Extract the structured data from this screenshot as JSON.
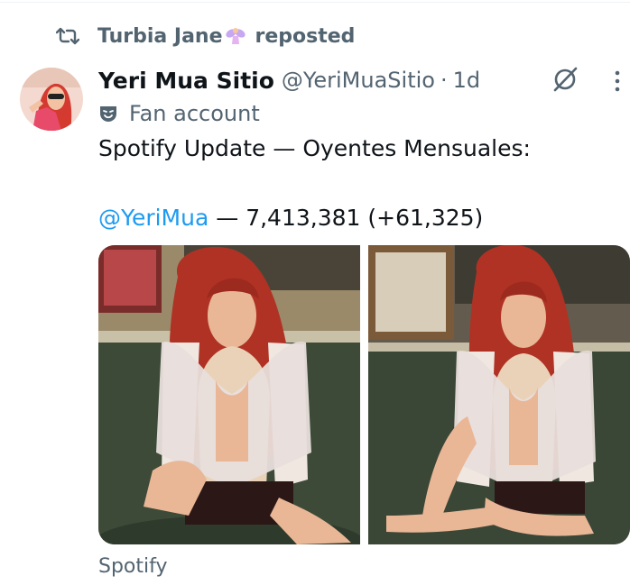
{
  "repost": {
    "icon": "repost-icon",
    "name": "Turbia Jane",
    "emoji": "fairy-emoji",
    "verb": "reposted"
  },
  "tweet": {
    "display_name": "Yeri Mua Sitio",
    "handle": "@YeriMuaSitio",
    "separator": "·",
    "time": "1d",
    "label": {
      "icon": "theater-mask-icon",
      "text": "Fan account"
    },
    "text_line1": "Spotify Update — Oyentes Mensuales:",
    "mention": "@YeriMua",
    "text_line2_rest": " — 7,413,381 (+61,325)",
    "media_source": "Spotify"
  },
  "colors": {
    "text_primary": "#0f1419",
    "text_secondary": "#536471",
    "link": "#1d9bf0",
    "hair": "#c0392b"
  }
}
